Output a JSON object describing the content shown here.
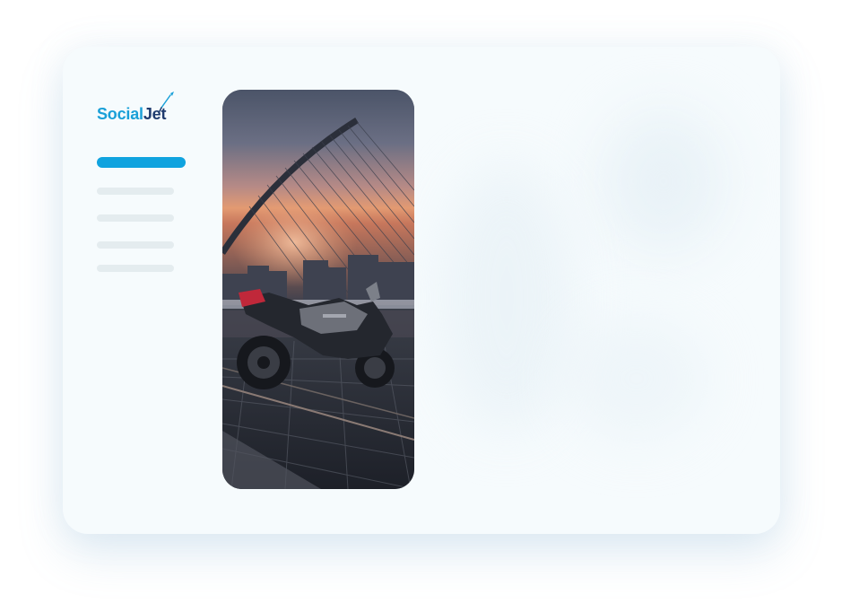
{
  "app": {
    "logo": {
      "text": "Social",
      "accent_text": "Jet",
      "brand_color": "#1aa0d8"
    }
  },
  "sidebar": {
    "items": [
      {
        "active": true
      },
      {
        "active": false
      },
      {
        "active": false
      },
      {
        "active": false
      },
      {
        "active": false
      }
    ],
    "active_color": "#10a3df",
    "inactive_color": "#e4ecef"
  },
  "preview": {
    "image": "motorcycle-at-bridge-sunset"
  }
}
